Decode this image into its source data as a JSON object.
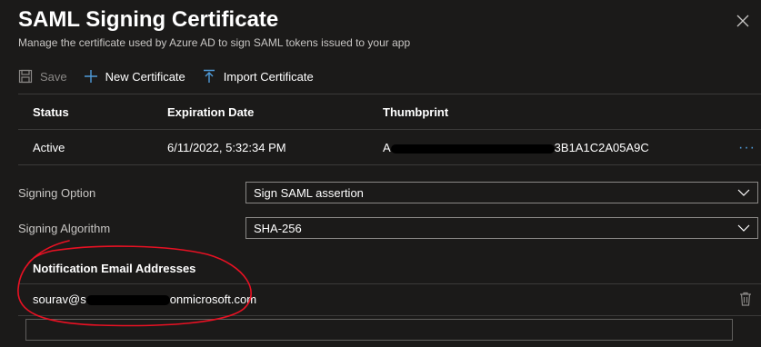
{
  "header": {
    "title": "SAML Signing Certificate",
    "subtitle": "Manage the certificate used by Azure AD to sign SAML tokens issued to your app"
  },
  "toolbar": {
    "save_label": "Save",
    "new_certificate_label": "New Certificate",
    "import_certificate_label": "Import Certificate"
  },
  "certificates": {
    "columns": [
      "Status",
      "Expiration Date",
      "Thumbprint"
    ],
    "rows": [
      {
        "status": "Active",
        "expiration": "6/11/2022, 5:32:34 PM",
        "thumbprint_prefix": "A",
        "thumbprint_suffix": "3B1A1C2A05A9C"
      }
    ],
    "more_label": "···"
  },
  "form": {
    "signing_option_label": "Signing Option",
    "signing_option_value": "Sign SAML assertion",
    "signing_algorithm_label": "Signing Algorithm",
    "signing_algorithm_value": "SHA-256"
  },
  "notifications": {
    "heading": "Notification Email Addresses",
    "emails": [
      {
        "prefix": "sourav@s",
        "suffix": "onmicrosoft.com"
      }
    ],
    "new_email_value": ""
  },
  "colors": {
    "background": "#1b1a19",
    "accent": "#4f9bd9",
    "annotation": "#e81123"
  },
  "icons": {
    "close": "close-icon",
    "save": "save-icon",
    "new": "plus-icon",
    "import": "upload-icon",
    "more": "more-icon",
    "chevron": "chevron-down-icon",
    "delete": "trash-icon"
  }
}
